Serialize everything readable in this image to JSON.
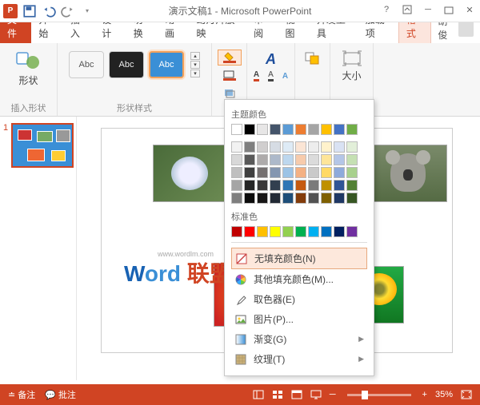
{
  "title": "演示文稿1 - Microsoft PowerPoint",
  "qat": {
    "save": "save",
    "undo": "undo",
    "redo": "redo"
  },
  "tabs": {
    "file": "文件",
    "home": "开始",
    "insert": "插入",
    "design": "设计",
    "transitions": "切换",
    "animations": "动画",
    "slideshow": "幻灯片放映",
    "review": "审阅",
    "view": "视图",
    "developer": "开发工具",
    "addins": "加载项",
    "format": "格式"
  },
  "user": "胡俊",
  "ribbon": {
    "insert_shape": "插入形状",
    "shapes": "形状",
    "shape_styles": "形状样式",
    "size": "大小",
    "sample": "Abc"
  },
  "fill_menu": {
    "theme_colors": "主题颜色",
    "standard_colors": "标准色",
    "no_fill": "无填充颜色(N)",
    "more_colors": "其他填充颜色(M)...",
    "eyedropper": "取色器(E)",
    "picture": "图片(P)...",
    "gradient": "渐变(G)",
    "texture": "纹理(T)",
    "theme_grid": [
      [
        "#ffffff",
        "#000000",
        "#e7e6e6",
        "#44546a",
        "#5b9bd5",
        "#ed7d31",
        "#a5a5a5",
        "#ffc000",
        "#4472c4",
        "#70ad47"
      ],
      [
        "#f2f2f2",
        "#7f7f7f",
        "#d0cece",
        "#d6dce4",
        "#deebf6",
        "#fbe5d5",
        "#ededed",
        "#fff2cc",
        "#d9e2f3",
        "#e2efd9"
      ],
      [
        "#d8d8d8",
        "#595959",
        "#aeabab",
        "#adb9ca",
        "#bdd7ee",
        "#f7cbac",
        "#dbdbdb",
        "#fee599",
        "#b4c6e7",
        "#c5e0b3"
      ],
      [
        "#bfbfbf",
        "#3f3f3f",
        "#757070",
        "#8496b0",
        "#9cc3e5",
        "#f4b183",
        "#c9c9c9",
        "#ffd965",
        "#8eaadb",
        "#a8d08d"
      ],
      [
        "#a5a5a5",
        "#262626",
        "#3a3838",
        "#323f4f",
        "#2e75b5",
        "#c55a11",
        "#7b7b7b",
        "#bf9000",
        "#2f5496",
        "#538135"
      ],
      [
        "#7f7f7f",
        "#0c0c0c",
        "#171616",
        "#222a35",
        "#1e4e79",
        "#833c0b",
        "#525252",
        "#7f6000",
        "#1f3864",
        "#375623"
      ]
    ],
    "standard_grid": [
      "#c00000",
      "#ff0000",
      "#ffc000",
      "#ffff00",
      "#92d050",
      "#00b050",
      "#00b0f0",
      "#0070c0",
      "#002060",
      "#7030a0"
    ]
  },
  "thumb": {
    "num": "1"
  },
  "watermark": {
    "word": "W",
    "ord": "ord",
    "lianmeng": "联盟",
    "url": "www.wordlm.com"
  },
  "status": {
    "notes": "备注",
    "comments": "批注",
    "zoom": "35%",
    "plus": "+",
    "gap": "◇"
  }
}
